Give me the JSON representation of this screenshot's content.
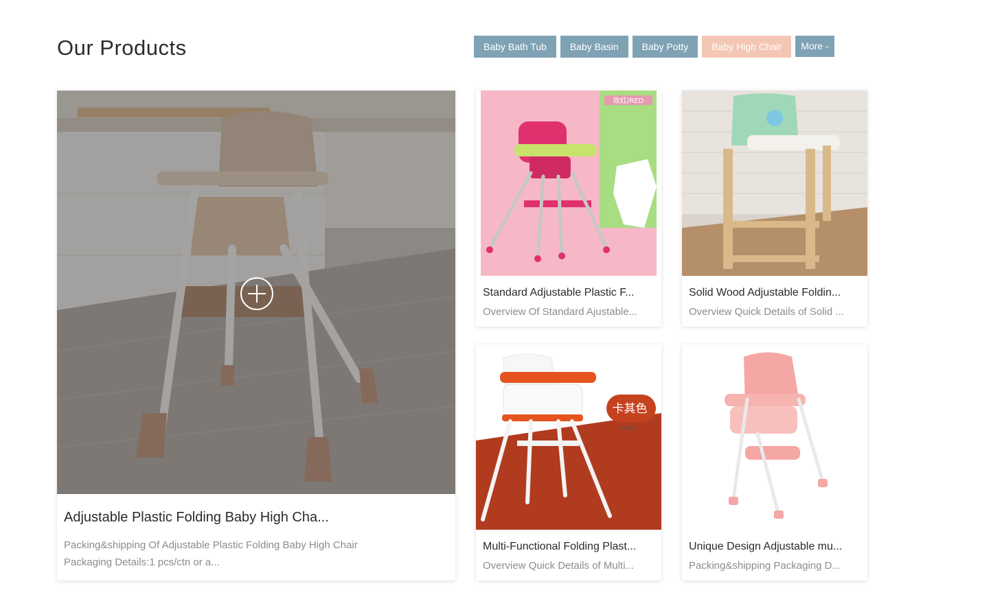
{
  "section": {
    "title": "Our Products"
  },
  "tabs": [
    {
      "label": "Baby Bath Tub",
      "active": false
    },
    {
      "label": "Baby Basin",
      "active": false
    },
    {
      "label": "Baby Potty",
      "active": false
    },
    {
      "label": "Baby High Chair",
      "active": true
    },
    {
      "label": "More -",
      "active": false
    }
  ],
  "featured": {
    "title": "Adjustable Plastic Folding Baby High Cha...",
    "desc_line1": "Packing&shipping Of Adjustable Plastic Folding Baby High Chair",
    "desc_line2": "Packaging Details:1 pcs/ctn or a..."
  },
  "products": [
    {
      "title": "Standard Adjustable Plastic F...",
      "desc": "Overview Of Standard Ajustable...",
      "image_badge": "玫红/RED"
    },
    {
      "title": "Solid Wood Adjustable Foldin...",
      "desc": "Overview Quick Details of Solid ..."
    },
    {
      "title": "Multi-Functional Folding Plast...",
      "desc": "Overview Quick Details of Multi...",
      "image_badge": "卡其色",
      "image_badge_sub": "khaki"
    },
    {
      "title": "Unique Design Adjustable mu...",
      "desc": "Packing&shipping Packaging D..."
    }
  ],
  "colors": {
    "tab": "#7fa2b5",
    "tab_active": "#f4c6b4"
  }
}
